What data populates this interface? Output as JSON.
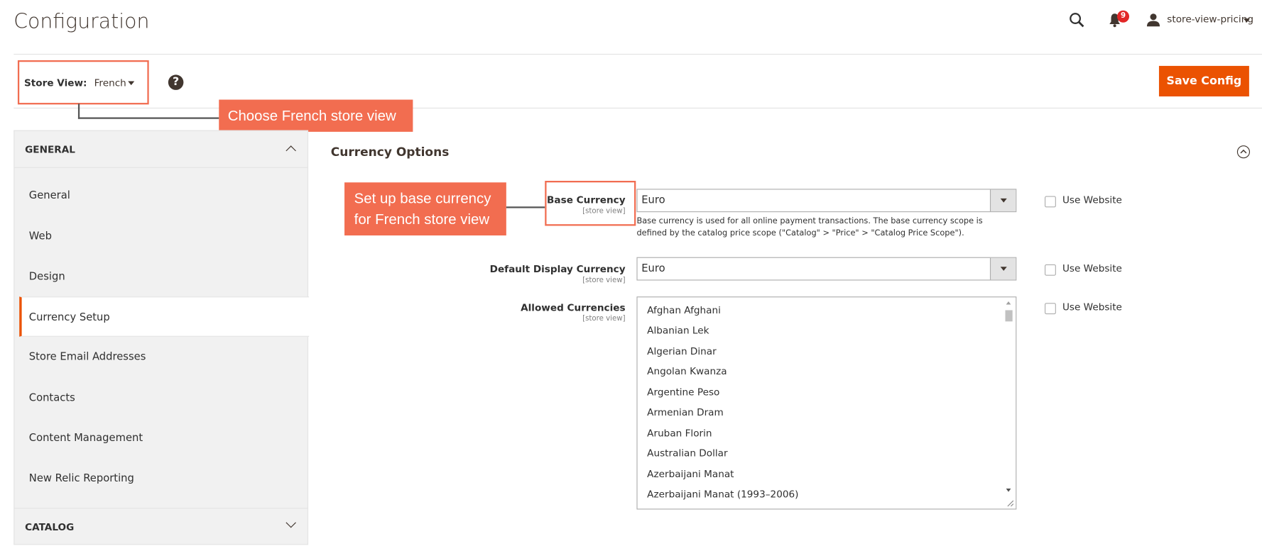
{
  "header": {
    "title": "Configuration",
    "notifications_count": "9",
    "user_name": "store-view-pricing"
  },
  "toolbar": {
    "store_view_label": "Store View:",
    "store_view_value": "French",
    "save_label": "Save Config"
  },
  "annotations": {
    "store_view_callout": "Choose French store view",
    "base_currency_callout_line1": "Set up base currency",
    "base_currency_callout_line2": "for French store view",
    "accent": "#f26d50"
  },
  "sidebar": {
    "sections": [
      {
        "label": "GENERAL",
        "expanded": true
      },
      {
        "label": "CATALOG",
        "expanded": false
      }
    ],
    "items": [
      {
        "label": "General"
      },
      {
        "label": "Web"
      },
      {
        "label": "Design"
      },
      {
        "label": "Currency Setup",
        "active": true
      },
      {
        "label": "Store Email Addresses"
      },
      {
        "label": "Contacts"
      },
      {
        "label": "Content Management"
      },
      {
        "label": "New Relic Reporting"
      }
    ]
  },
  "main": {
    "section_title": "Currency Options",
    "fields": [
      {
        "label": "Base Currency",
        "scope": "[store view]",
        "value": "Euro",
        "note": "Base currency is used for all online payment transactions. The base currency scope is defined by the catalog price scope (\"Catalog\" > \"Price\" > \"Catalog Price Scope\").",
        "use_website": "Use Website"
      },
      {
        "label": "Default Display Currency",
        "scope": "[store view]",
        "value": "Euro",
        "use_website": "Use Website"
      },
      {
        "label": "Allowed Currencies",
        "scope": "[store view]",
        "use_website": "Use Website",
        "options": [
          "Afghan Afghani",
          "Albanian Lek",
          "Algerian Dinar",
          "Angolan Kwanza",
          "Argentine Peso",
          "Armenian Dram",
          "Aruban Florin",
          "Australian Dollar",
          "Azerbaijani Manat",
          "Azerbaijani Manat (1993–2006)"
        ]
      }
    ]
  },
  "colors": {
    "primary_button": "#eb5202",
    "badge": "#e22626"
  }
}
